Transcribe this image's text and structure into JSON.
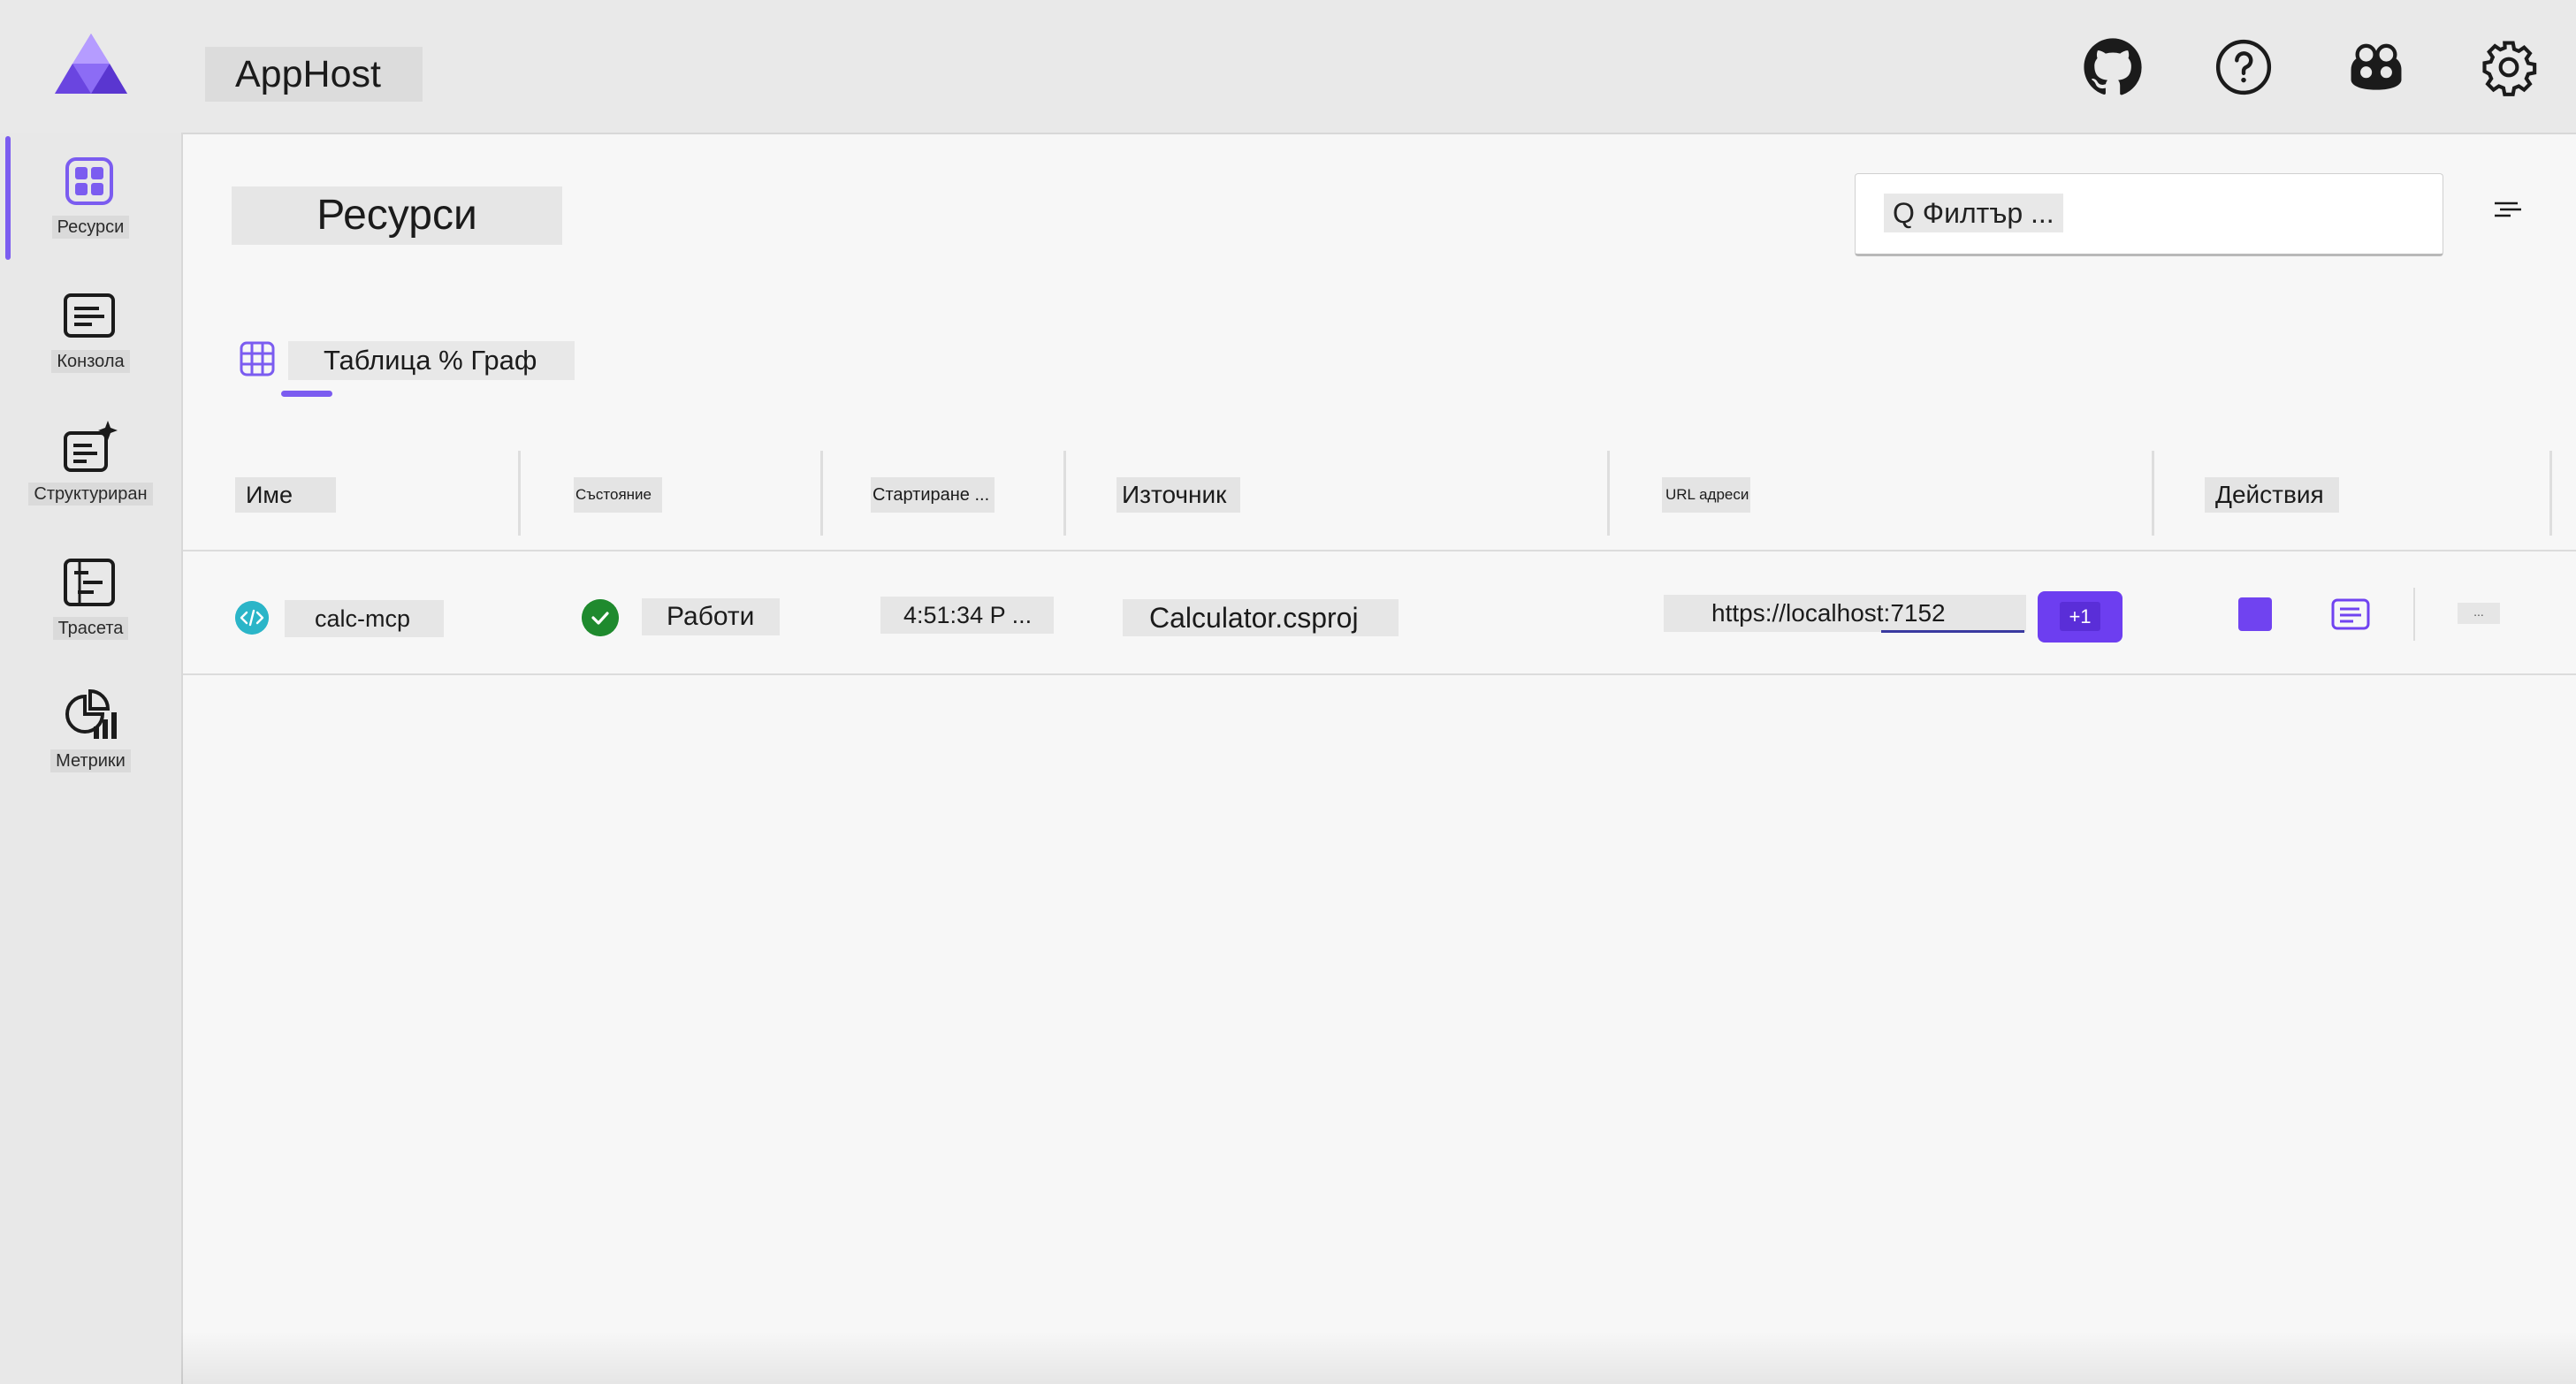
{
  "app": {
    "title": "AppHost"
  },
  "sidebar": {
    "items": [
      {
        "label": "Ресурси",
        "icon": "resources-icon",
        "active": true
      },
      {
        "label": "Конзола",
        "icon": "console-icon",
        "active": false
      },
      {
        "label": "Структуриран",
        "icon": "structured-logs-icon",
        "active": false
      },
      {
        "label": "Трасета",
        "icon": "traces-icon",
        "active": false
      },
      {
        "label": "Метрики",
        "icon": "metrics-icon",
        "active": false
      }
    ]
  },
  "header_icons": [
    "github-icon",
    "help-icon",
    "copilot-icon",
    "settings-icon"
  ],
  "page": {
    "title": "Ресурси",
    "filter_placeholder": "Q Филтър ...",
    "tabs_label": "Таблица % Граф"
  },
  "table": {
    "columns": [
      "Име",
      "Състояние",
      "Стартиране ...",
      "Източник",
      "URL адреси",
      "Действия"
    ],
    "rows": [
      {
        "name": "calc-mcp",
        "state": "Работи",
        "start": "4:51:34 P ...",
        "source": "Calculator.csproj",
        "url": "https://localhost:7152",
        "url_extra": "+1",
        "more": "..."
      }
    ]
  },
  "colors": {
    "accent": "#7b5cf0",
    "running": "#1f8a2e",
    "project": "#2bb5c8",
    "badge": "#6d3ef0"
  }
}
